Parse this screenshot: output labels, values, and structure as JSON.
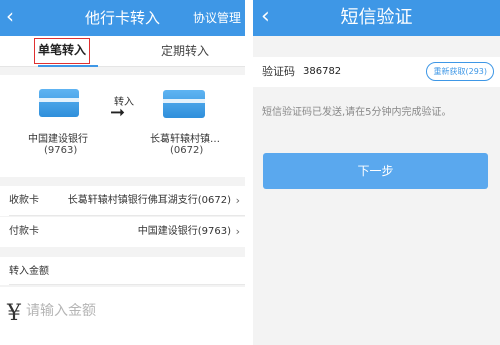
{
  "left": {
    "nav": {
      "back_icon": "‹",
      "title": "他行卡转入",
      "right": "协议管理"
    },
    "tabs": [
      "单笔转入",
      "定期转入"
    ],
    "from_bank": {
      "name": "中国建设银行",
      "number": "(9763)"
    },
    "to_bank": {
      "name": "长葛轩辕村镇…",
      "number": "(0672)"
    },
    "arrow_label": "转入",
    "arrow_icon": "➞",
    "rows": {
      "receive": {
        "label": "收款卡",
        "value": "长葛轩辕村镇银行佛耳湖支行(0672)"
      },
      "pay": {
        "label": "付款卡",
        "value": "中国建设银行(9763)"
      }
    },
    "chevron": "›",
    "amount": {
      "label": "转入金额",
      "currency": "¥",
      "placeholder": "请输入金额"
    }
  },
  "right": {
    "nav": {
      "back_icon": "‹",
      "title": "短信验证"
    },
    "verify_label": "验证码",
    "verify_code": "386782",
    "resend_label": "重新获取(293)",
    "hint": "短信验证码已发送,请在5分钟内完成验证。",
    "next_label": "下一步"
  },
  "colors": {
    "accent": "#3e97e6",
    "button": "#5aa8ee",
    "tab_highlight": "#e03030"
  }
}
